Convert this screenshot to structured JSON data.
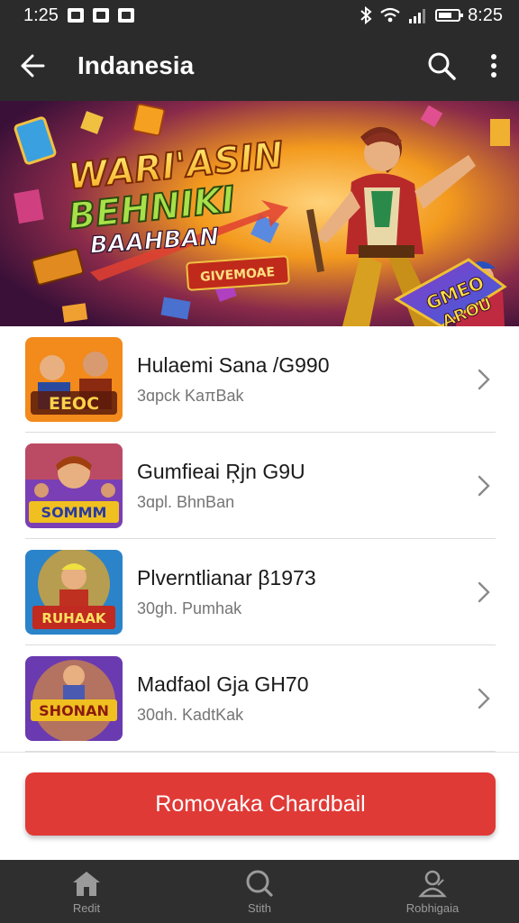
{
  "status_bar": {
    "time_left": "1:25",
    "time_right": "8:25"
  },
  "app_bar": {
    "title": "Indanesia"
  },
  "banner": {
    "headline_line1": "WARI'ASIN",
    "headline_line2": "BEHNIKI",
    "headline_line3": "BAAHBAN",
    "tag_label": "GIVEMOAE",
    "board_label_1": "GMEO",
    "board_label_2": "AROU",
    "colors": {
      "background": "#5a1d40",
      "glow": "#ffb020",
      "text_fill": "#ffd24a",
      "text_stroke": "#7a2a00"
    }
  },
  "list": {
    "items": [
      {
        "title": "Hulaemi Sana /G990",
        "subtitle": "3ɑpck KaπBak",
        "thumb_label": "EEOC",
        "thumb_colors": [
          "#f28a1c",
          "#8a2a10"
        ]
      },
      {
        "title": "Gumfieai Ŗjn G9U",
        "subtitle": "3ɑpl. BhnBan",
        "thumb_label": "SOMMM",
        "thumb_colors": [
          "#7a3fb4",
          "#e6532f"
        ]
      },
      {
        "title": "Plverntlianar β1973",
        "subtitle": "30gh. Pumhak",
        "thumb_label": "RUHAAK",
        "thumb_colors": [
          "#2b83c9",
          "#f2a81c"
        ]
      },
      {
        "title": "Madfaol Gja GH70",
        "subtitle": "30ɑh. KadtKak",
        "thumb_label": "SHONAN",
        "thumb_colors": [
          "#6a3ab0",
          "#f0a020"
        ]
      }
    ]
  },
  "action": {
    "label": "Romovaka Chardbail",
    "color": "#e03a36"
  },
  "bottom_nav": {
    "items": [
      {
        "label": "Redit",
        "icon": "home-icon"
      },
      {
        "label": "Stith",
        "icon": "search-icon"
      },
      {
        "label": "Robhigaia",
        "icon": "profile-icon"
      }
    ]
  }
}
